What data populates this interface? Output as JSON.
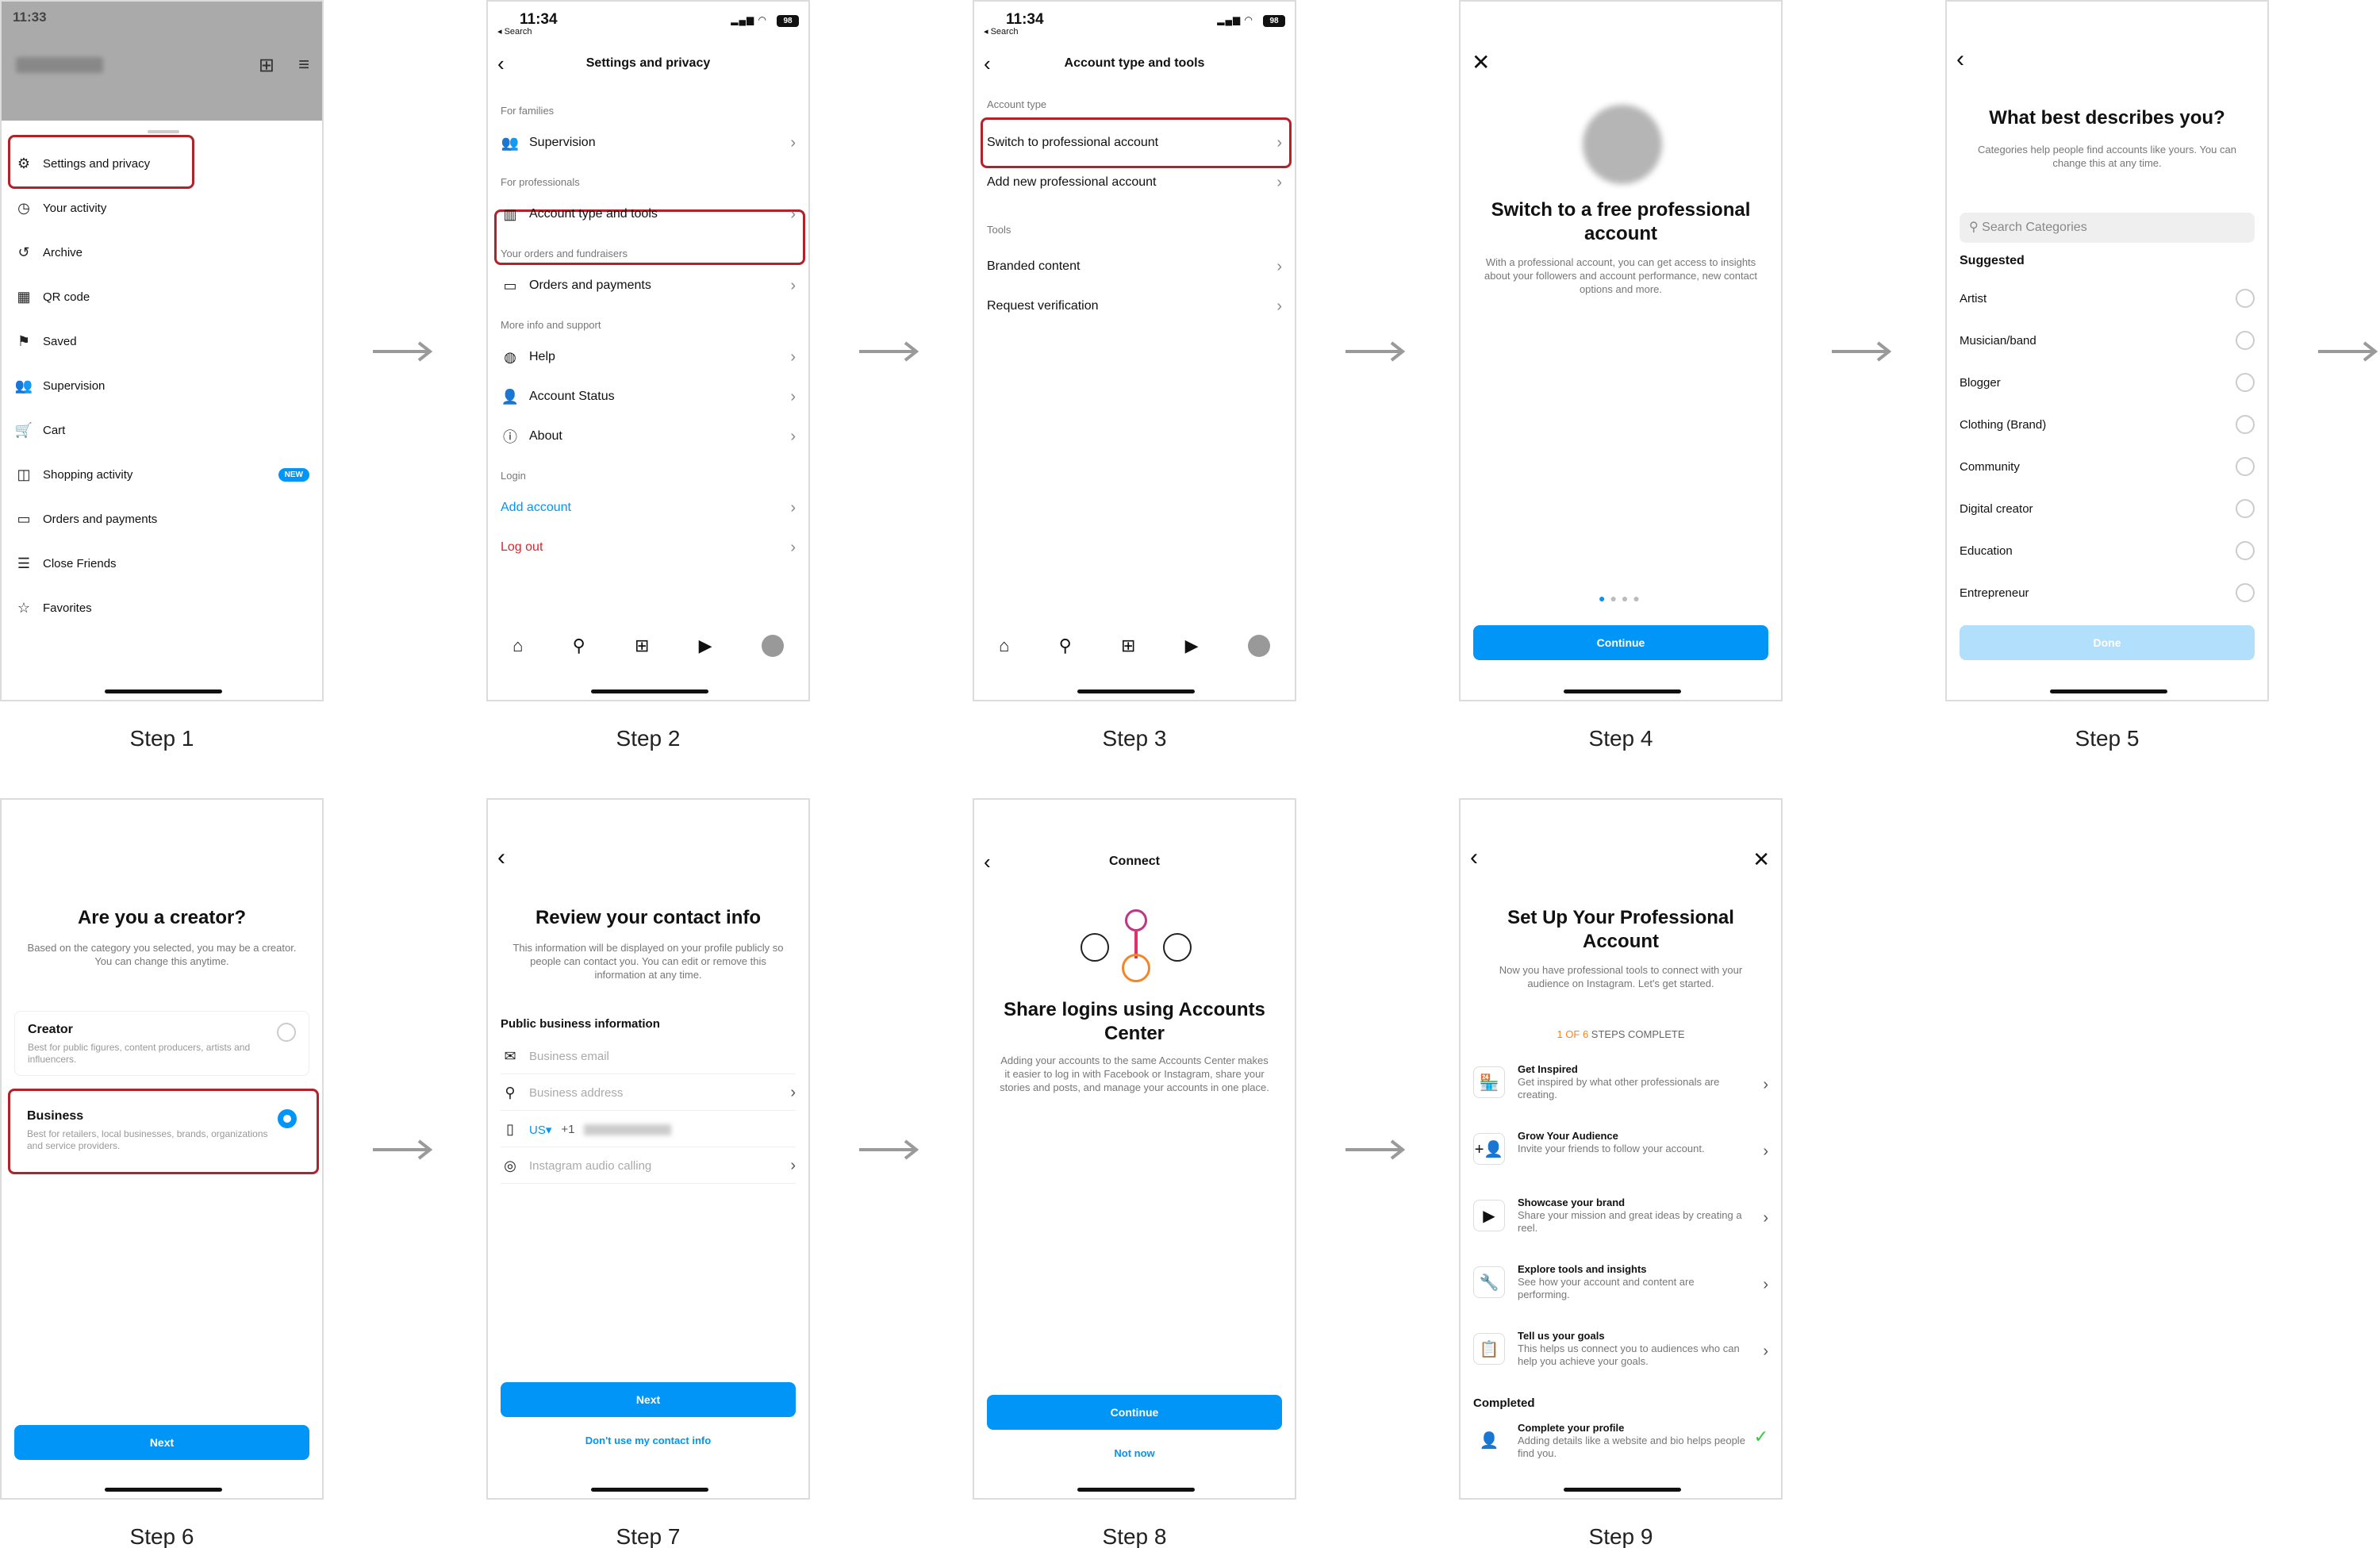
{
  "status": {
    "time": "11:34",
    "time1": "11:33",
    "back": "◂ Search",
    "battery": "98"
  },
  "arrow_glyph": "→",
  "steps": [
    "Step 1",
    "Step 2",
    "Step 3",
    "Step 4",
    "Step 5",
    "Step 6",
    "Step 7",
    "Step 8",
    "Step 9"
  ],
  "s1": {
    "items": [
      {
        "label": "Settings and privacy",
        "icon": "gear-icon"
      },
      {
        "label": "Your activity",
        "icon": "activity-icon"
      },
      {
        "label": "Archive",
        "icon": "archive-icon"
      },
      {
        "label": "QR code",
        "icon": "qr-icon"
      },
      {
        "label": "Saved",
        "icon": "bookmark-icon"
      },
      {
        "label": "Supervision",
        "icon": "people-icon"
      },
      {
        "label": "Cart",
        "icon": "cart-icon"
      },
      {
        "label": "Shopping activity",
        "icon": "bag-icon",
        "badge": "NEW"
      },
      {
        "label": "Orders and payments",
        "icon": "card-icon"
      },
      {
        "label": "Close Friends",
        "icon": "list-icon"
      },
      {
        "label": "Favorites",
        "icon": "star-icon"
      }
    ]
  },
  "s2": {
    "title": "Settings and privacy",
    "sections": [
      {
        "head": "For families",
        "rows": [
          "Supervision"
        ]
      },
      {
        "head": "For professionals",
        "rows": [
          "Account type and tools"
        ]
      },
      {
        "head": "Your orders and fundraisers",
        "rows": [
          "Orders and payments"
        ]
      },
      {
        "head": "More info and support",
        "rows": [
          "Help",
          "Account Status",
          "About"
        ]
      },
      {
        "head": "Login",
        "rows": [
          "Add account",
          "Log out"
        ]
      }
    ]
  },
  "s3": {
    "title": "Account type and tools",
    "sec1": "Account type",
    "rows1": [
      "Switch to professional account",
      "Add new professional account"
    ],
    "sec2": "Tools",
    "rows2": [
      "Branded content",
      "Request verification"
    ]
  },
  "s4": {
    "title": "Switch to a free professional account",
    "sub": "With a professional account, you can get access to insights about your followers and account performance, new contact options and more.",
    "button": "Continue"
  },
  "s5": {
    "title": "What best describes you?",
    "sub": "Categories help people find accounts like yours. You can change this at any time.",
    "search": "Search Categories",
    "suggested": "Suggested",
    "cats": [
      "Artist",
      "Musician/band",
      "Blogger",
      "Clothing (Brand)",
      "Community",
      "Digital creator",
      "Education",
      "Entrepreneur"
    ],
    "button": "Done"
  },
  "s6": {
    "title": "Are you a creator?",
    "sub": "Based on the category you selected, you may be a creator. You can change this anytime.",
    "opt1": "Creator",
    "opt1d": "Best for public figures, content producers, artists and influencers.",
    "opt2": "Business",
    "opt2d": "Best for retailers, local businesses, brands, organizations and service providers.",
    "button": "Next"
  },
  "s7": {
    "title": "Review your contact info",
    "sub": "This information will be displayed on your profile publicly so people can contact you. You can edit or remove this information at any time.",
    "head": "Public business information",
    "email": "Business email",
    "address": "Business address",
    "country": "US▾",
    "code": "+1",
    "audio": "Instagram audio calling",
    "button": "Next",
    "link": "Don't use my contact info"
  },
  "s8": {
    "hdr": "Connect",
    "title": "Share logins using Accounts Center",
    "sub": "Adding your accounts to the same Accounts Center makes it easier to log in with Facebook or Instagram, share your stories and posts, and manage your accounts in one place.",
    "button": "Continue",
    "link": "Not now"
  },
  "s9": {
    "title": "Set Up Your Professional Account",
    "sub": "Now you have professional tools to connect with your audience on Instagram. Let's get started.",
    "progress_a": "1 OF 6",
    "progress_b": " STEPS COMPLETE",
    "items": [
      {
        "t": "Get Inspired",
        "d": "Get inspired by what other professionals are creating.",
        "icon": "store-icon",
        "g": "🏪"
      },
      {
        "t": "Grow Your Audience",
        "d": "Invite your friends to follow your account.",
        "icon": "add-person-icon",
        "g": "+👤"
      },
      {
        "t": "Showcase your brand",
        "d": "Share your mission and great ideas by creating a reel.",
        "icon": "reel-icon",
        "g": "▶"
      },
      {
        "t": "Explore tools and insights",
        "d": "See how your account and content are performing.",
        "icon": "wrench-icon",
        "g": "🔧"
      },
      {
        "t": "Tell us your goals",
        "d": "This helps us connect you to audiences who can help you achieve your goals.",
        "icon": "clipboard-icon",
        "g": "📋"
      }
    ],
    "completed": "Completed",
    "done_t": "Complete your profile",
    "done_d": "Adding details like a website and bio helps people find you."
  }
}
